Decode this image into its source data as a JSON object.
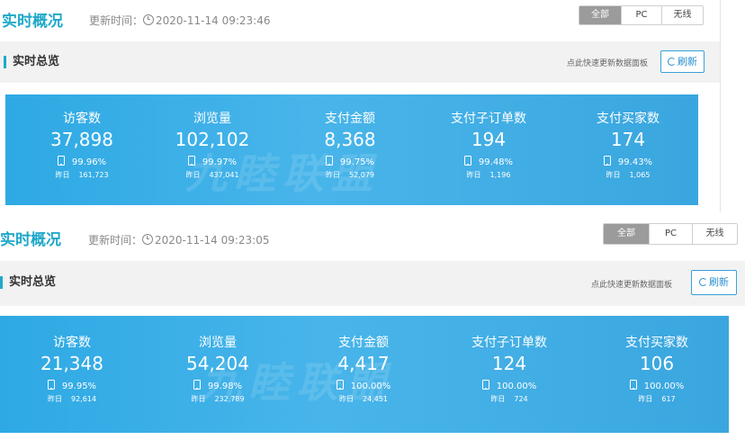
{
  "panels": [
    {
      "title": "实时概况",
      "updated_label": "更新时间：",
      "updated_time": "2020-11-14 09:23:46",
      "segments": [
        {
          "label": "全部",
          "active": true
        },
        {
          "label": "PC",
          "active": false
        },
        {
          "label": "无线",
          "active": false
        }
      ],
      "section_title": "实时总览",
      "refresh_hint": "点此快速更新数据面板",
      "refresh_label": "刷新",
      "watermark": "九睦联盟",
      "metrics": [
        {
          "label": "访客数",
          "value": "37,898",
          "pct": "99.96%",
          "yest_label": "昨日",
          "yest": "161,723"
        },
        {
          "label": "浏览量",
          "value": "102,102",
          "pct": "99.97%",
          "yest_label": "昨日",
          "yest": "437,041"
        },
        {
          "label": "支付金额",
          "value": "8,368",
          "pct": "99.75%",
          "yest_label": "昨日",
          "yest": "52,079"
        },
        {
          "label": "支付子订单数",
          "value": "194",
          "pct": "99.48%",
          "yest_label": "昨日",
          "yest": "1,196"
        },
        {
          "label": "支付买家数",
          "value": "174",
          "pct": "99.43%",
          "yest_label": "昨日",
          "yest": "1,065"
        }
      ]
    },
    {
      "title": "实时概况",
      "updated_label": "更新时间：",
      "updated_time": "2020-11-14 09:23:05",
      "segments": [
        {
          "label": "全部",
          "active": true
        },
        {
          "label": "PC",
          "active": false
        },
        {
          "label": "无线",
          "active": false
        }
      ],
      "section_title": "实时总览",
      "refresh_hint": "点此快速更新数据面板",
      "refresh_label": "刷新",
      "watermark": "九睦联盟",
      "metrics": [
        {
          "label": "访客数",
          "value": "21,348",
          "pct": "99.95%",
          "yest_label": "昨日",
          "yest": "92,614"
        },
        {
          "label": "浏览量",
          "value": "54,204",
          "pct": "99.98%",
          "yest_label": "昨日",
          "yest": "232,789"
        },
        {
          "label": "支付金额",
          "value": "4,417",
          "pct": "100.00%",
          "yest_label": "昨日",
          "yest": "24,451"
        },
        {
          "label": "支付子订单数",
          "value": "124",
          "pct": "100.00%",
          "yest_label": "昨日",
          "yest": "724"
        },
        {
          "label": "支付买家数",
          "value": "106",
          "pct": "100.00%",
          "yest_label": "昨日",
          "yest": "617"
        }
      ]
    }
  ]
}
